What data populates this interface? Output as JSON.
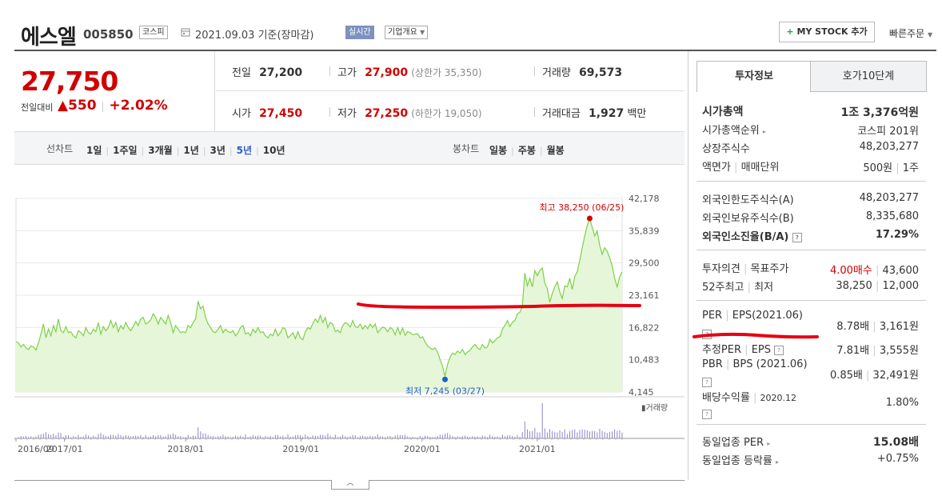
{
  "header": {
    "name": "에스엘",
    "code": "005850",
    "market": "코스피",
    "date": "2021.09.03 기준(장마감)",
    "realtime": "실시간",
    "company_info": "기업개요",
    "mystock": "MY STOCK 추가",
    "quick_order": "빠른주문"
  },
  "price": {
    "current": "27,750",
    "change_label": "전일대비",
    "change": "▲550",
    "change_pct": "+2.02%"
  },
  "info": {
    "prev_label": "전일",
    "prev": "27,200",
    "high_label": "고가",
    "high": "27,900",
    "upper_limit": "(상한가 35,350)",
    "volume_label": "거래량",
    "volume": "69,573",
    "open_label": "시가",
    "open": "27,450",
    "low_label": "저가",
    "low": "27,250",
    "lower_limit": "(하한가 19,050)",
    "amount_label": "거래대금",
    "amount": "1,927",
    "amount_unit": "백만"
  },
  "chart_tabs": {
    "line_label": "선차트",
    "periods": [
      "1일",
      "1주일",
      "3개월",
      "1년",
      "3년",
      "5년",
      "10년"
    ],
    "selected": "5년",
    "candle_label": "봉차트",
    "candles": [
      "일봉",
      "주봉",
      "월봉"
    ]
  },
  "right_tabs": {
    "invest": "투자정보",
    "quote": "호가10단계"
  },
  "invest": {
    "mcap_label": "시가총액",
    "mcap": "1조 3,376억원",
    "mcap_rank_label": "시가총액순위",
    "mcap_rank": "코스피 201위",
    "shares_label": "상장주식수",
    "shares": "48,203,277",
    "par_label": "액면가",
    "trade_unit_label": "매매단위",
    "par": "500원",
    "trade_unit": "1주",
    "foreign_limit_label": "외국인한도주식수(A)",
    "foreign_limit": "48,203,277",
    "foreign_hold_label": "외국인보유주식수(B)",
    "foreign_hold": "8,335,680",
    "foreign_ratio_label": "외국인소진율(B/A)",
    "foreign_ratio": "17.29%",
    "opinion_label": "투자의견",
    "target_label": "목표주가",
    "opinion": "4.00매수",
    "target": "43,600",
    "w52_label": "52주최고",
    "w52_low_label": "최저",
    "w52_high": "38,250",
    "w52_low": "12,000",
    "per_label": "PER",
    "eps_label": "EPS(2021.06)",
    "per": "8.78배",
    "eps": "3,161원",
    "est_per_label": "추정PER",
    "est_eps_label": "EPS",
    "est_per": "7.81배",
    "est_eps": "3,555원",
    "pbr_label": "PBR",
    "bps_label": "BPS (2021.06)",
    "pbr": "0.85배",
    "bps": "32,491원",
    "div_label": "배당수익률",
    "div_date": "2020.12",
    "div": "1.80%",
    "ind_per_label": "동일업종 PER",
    "ind_per": "15.08배",
    "ind_rate_label": "동일업종 등락률",
    "ind_rate": "+0.75%"
  },
  "chart_data": {
    "type": "area",
    "y_ticks": [
      "42,178",
      "35,839",
      "29,500",
      "23,161",
      "16,822",
      "10,483",
      "4,145"
    ],
    "ylim": [
      4145,
      42178
    ],
    "x_ticks": [
      "2016/09",
      "2017/01",
      "2018/01",
      "2019/01",
      "2020/01",
      "2021/01"
    ],
    "x_tick_positions": [
      0,
      0.08,
      0.28,
      0.47,
      0.67,
      0.86
    ],
    "max_annotation": "최고 38,250 (06/25)",
    "min_annotation": "최저 7,245 (03/27)",
    "volume_label": "거래량",
    "series": [
      {
        "values": [
          14000,
          13800,
          13000,
          13500,
          12800,
          12500,
          13200,
          13000,
          12400,
          13800,
          15500,
          17500,
          14800,
          16500,
          15200,
          17200,
          16000,
          18500,
          16200,
          15800,
          17000,
          15800,
          16000,
          15200,
          14800,
          16200,
          15800,
          15200,
          16800,
          15800,
          15500,
          16500,
          16000,
          17800,
          15500,
          17000,
          16200,
          16800,
          18200,
          16800,
          17800,
          16000,
          17200,
          16500,
          17800,
          16800,
          16200,
          17000,
          18000,
          17200,
          18500,
          18800,
          17500,
          17800,
          18300,
          19500,
          18800,
          17500,
          18800,
          18200,
          17500,
          19200,
          17800,
          15800,
          17200,
          16500,
          15800,
          16000,
          15800,
          17200,
          16800,
          17800,
          18500,
          22000,
          20500,
          21000,
          18800,
          17500,
          16800,
          16000,
          15800,
          16500,
          17200,
          15800,
          16500,
          16000,
          15800,
          16200,
          15200,
          15800,
          16800,
          17200,
          15500,
          15800,
          15200,
          16500,
          15800,
          16800,
          15800,
          16000,
          15200,
          14800,
          15500,
          15200,
          16500,
          15200,
          15800,
          16800,
          16500,
          14800,
          15200,
          15800,
          14600,
          16000,
          14800,
          14400,
          16000,
          16800,
          16500,
          17600,
          18500,
          17800,
          19200,
          17800,
          18800,
          16800,
          17800,
          17500,
          16000,
          16300,
          15800,
          17200,
          17800,
          17500,
          16900,
          18200,
          17000,
          16800,
          17500,
          16500,
          17200,
          16600,
          17500,
          16800,
          17500,
          15800,
          16400,
          16900,
          16700,
          16000,
          16800,
          16500,
          15400,
          16800,
          15500,
          16700,
          15300,
          16000,
          15800,
          15400,
          15500,
          15600,
          14800,
          15000,
          14000,
          13200,
          12800,
          12500,
          12800,
          12000,
          10500,
          9200,
          7245,
          9500,
          11000,
          11800,
          11500,
          12200,
          11800,
          12500,
          11500,
          12000,
          12300,
          13000,
          13500,
          12800,
          12500,
          13500,
          12800,
          13000,
          14500,
          13800,
          14200,
          14800,
          15000,
          16500,
          17200,
          18200,
          17000,
          17800,
          18200,
          19500,
          19800,
          21000,
          27500,
          25000,
          26500,
          24800,
          28000,
          27000,
          28000,
          28500,
          25500,
          24500,
          21800,
          23500,
          24800,
          25800,
          23800,
          22500,
          25000,
          24800,
          26500,
          24300,
          26800,
          27800,
          30000,
          32500,
          34800,
          36800,
          38250,
          36500,
          34800,
          35800,
          33000,
          31200,
          32500,
          31800,
          30500,
          29000,
          26500,
          24800,
          26800,
          27750
        ]
      }
    ]
  },
  "annotation_colors": {
    "max": "#d10000",
    "min": "#1f5fc7",
    "line": "#e60012",
    "area_fill": "#e6f6d8",
    "area_stroke": "#7fcf4a"
  }
}
